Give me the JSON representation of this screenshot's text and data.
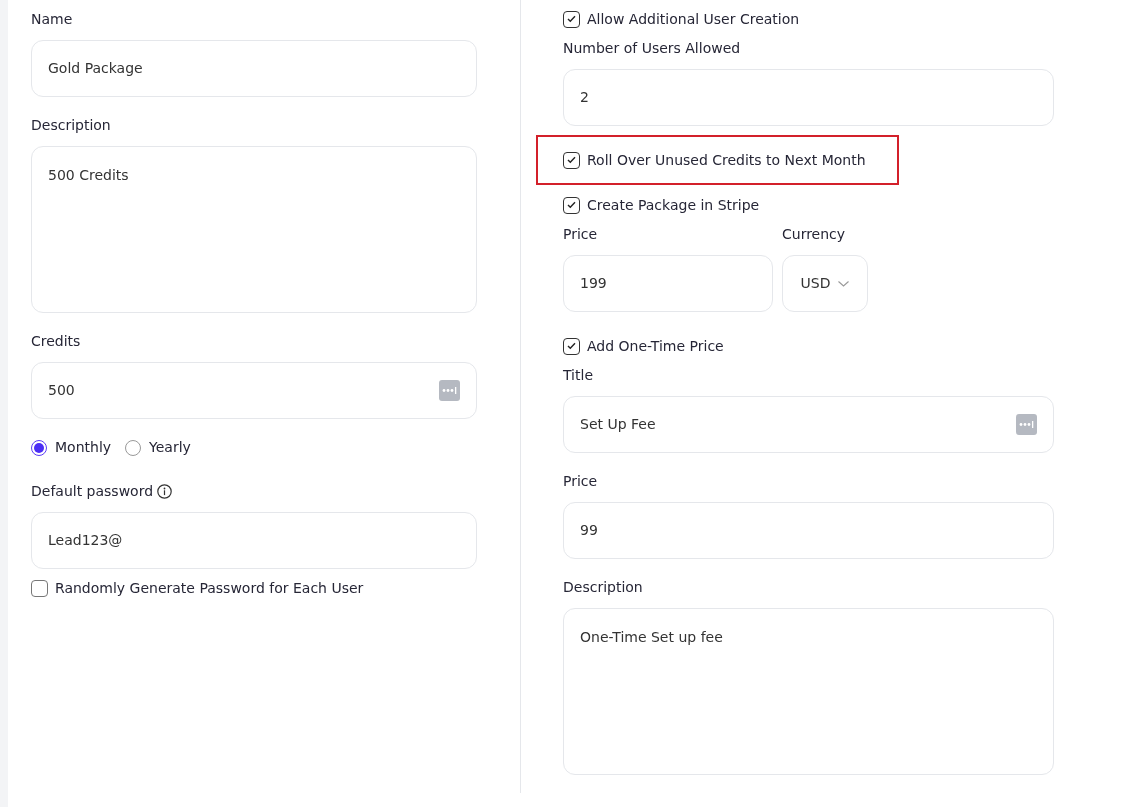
{
  "left": [
    {
      "kind": "text",
      "label": "Name",
      "value": "Gold Package"
    },
    {
      "kind": "textarea",
      "label": "Description",
      "value": "500 Credits"
    },
    {
      "kind": "text",
      "label": "Credits",
      "value": "500",
      "widget": true
    },
    {
      "kind": "radios",
      "options": [
        {
          "label": "Monthly",
          "selected": true
        },
        {
          "label": "Yearly",
          "selected": false
        }
      ]
    },
    {
      "kind": "text",
      "label": "Default password",
      "info": true,
      "value": "Lead123@"
    },
    {
      "kind": "checkbox",
      "label": "Randomly Generate Password for Each User",
      "checked": false
    }
  ],
  "right": [
    {
      "kind": "checkbox",
      "label": "Allow Additional User Creation",
      "checked": true
    },
    {
      "kind": "text",
      "label": "Number of Users Allowed",
      "value": "2"
    },
    {
      "kind": "checkbox",
      "label": "Roll Over Unused Credits to Next Month",
      "checked": true,
      "highlighted": true
    },
    {
      "kind": "checkbox",
      "label": "Create Package in Stripe",
      "checked": true
    },
    {
      "kind": "pair",
      "label": "Price",
      "value": "199",
      "select_label": "Currency",
      "select_value": "USD"
    },
    {
      "kind": "checkbox",
      "label": "Add One-Time Price",
      "checked": true
    },
    {
      "kind": "text",
      "label": "Title",
      "value": "Set Up Fee",
      "widget": true
    },
    {
      "kind": "text",
      "label": "Price",
      "value": "99"
    },
    {
      "kind": "textarea",
      "label": "Description",
      "value": "One-Time Set up fee"
    }
  ]
}
